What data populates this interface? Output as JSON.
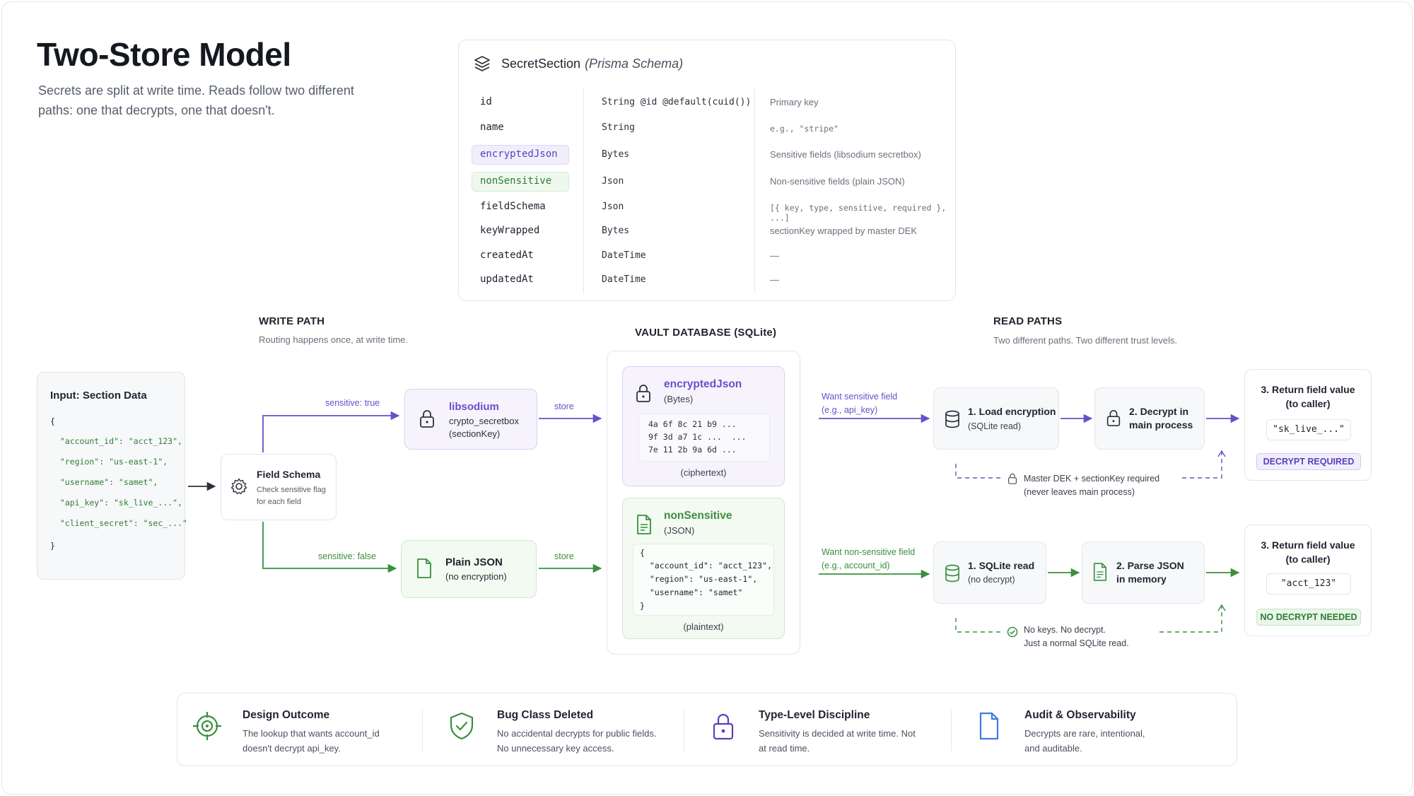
{
  "header": {
    "title": "Two-Store Model",
    "subtitle_line1": "Secrets are split at write time. Reads follow two different",
    "subtitle_line2": "paths: one that decrypts, one that doesn't."
  },
  "schema": {
    "model": "SecretSection",
    "model_note": "(Prisma Schema)",
    "rows": [
      {
        "name": "id",
        "type": "String @id @default(cuid())",
        "desc": "Primary key"
      },
      {
        "name": "name",
        "type": "String",
        "desc": "e.g., \"stripe\""
      },
      {
        "name": "encryptedJson",
        "type": "Bytes",
        "desc": "Sensitive fields (libsodium secretbox)"
      },
      {
        "name": "nonSensitive",
        "type": "Json",
        "desc": "Non-sensitive fields (plain JSON)"
      },
      {
        "name": "fieldSchema",
        "type": "Json",
        "desc": "[{ key, type, sensitive, required }, ...]"
      },
      {
        "name": "keyWrapped",
        "type": "Bytes",
        "desc": "sectionKey wrapped by master DEK"
      },
      {
        "name": "createdAt",
        "type": "DateTime",
        "desc": "—"
      },
      {
        "name": "updatedAt",
        "type": "DateTime",
        "desc": "—"
      }
    ]
  },
  "write_path": {
    "title": "WRITE PATH",
    "subtitle": "Routing happens once, at write time.",
    "input_title": "Input: Section Data",
    "input_lines": [
      "{",
      "  \"account_id\": \"acct_123\",",
      "  \"region\": \"us-east-1\",",
      "  \"username\": \"samet\",",
      "  \"api_key\": \"sk_live_...\",",
      "  \"client_secret\": \"sec_...\"",
      "}"
    ],
    "field_schema_title": "Field Schema",
    "field_schema_sub": "Check sensitive flag for each field",
    "edge_true": "sensitive: true",
    "edge_false": "sensitive: false",
    "libsodium_title": "libsodium",
    "libsodium_sub1": "crypto_secretbox",
    "libsodium_sub2": "(sectionKey)",
    "plain_title": "Plain JSON",
    "plain_sub": "(no encryption)",
    "store_label": "store"
  },
  "vault": {
    "title": "VAULT DATABASE (SQLite)",
    "enc_title": "encryptedJson",
    "enc_sub": "(Bytes)",
    "hex_lines": [
      "4a 6f 8c 21 b9 ...",
      "9f 3d a7 1c ...  ...",
      "7e 11 2b 9a 6d ..."
    ],
    "enc_caption": "(ciphertext)",
    "ns_title": "nonSensitive",
    "ns_sub": "(JSON)",
    "json_lines": [
      "{",
      "  \"account_id\": \"acct_123\",",
      "  \"region\": \"us-east-1\",",
      "  \"username\": \"samet\"",
      "}"
    ],
    "ns_caption": "(plaintext)"
  },
  "read_paths": {
    "title": "READ PATHS",
    "subtitle": "Two different paths. Two different trust levels.",
    "sensitive": {
      "want_line1": "Want sensitive field",
      "want_line2": "(e.g., api_key)",
      "step1_title": "1. Load encryption",
      "step1_sub": "(SQLite read)",
      "step2_title_l1": "2. Decrypt in",
      "step2_title_l2": "main process",
      "step3_title_l1": "3. Return field value",
      "step3_title_l2": "(to caller)",
      "value": "\"sk_live_...\"",
      "badge": "DECRYPT REQUIRED",
      "note_l1": "Master DEK + sectionKey required",
      "note_l2": "(never leaves main process)"
    },
    "non_sensitive": {
      "want_line1": "Want non-sensitive field",
      "want_line2": "(e.g., account_id)",
      "step1_title": "1. SQLite read",
      "step1_sub": "(no decrypt)",
      "step2_title_l1": "2. Parse JSON",
      "step2_title_l2": "in memory",
      "step3_title_l1": "3. Return field value",
      "step3_title_l2": "(to caller)",
      "value": "\"acct_123\"",
      "badge": "NO DECRYPT NEEDED",
      "note_l1": "No keys. No decrypt.",
      "note_l2": "Just a normal SQLite read."
    }
  },
  "footer": [
    {
      "title": "Design Outcome",
      "desc": "The lookup that wants account_id doesn't decrypt api_key.",
      "icon": "crosshair-icon"
    },
    {
      "title": "Bug Class Deleted",
      "desc": "No accidental decrypts for public fields. No unnecessary key access.",
      "icon": "shield-check-icon"
    },
    {
      "title": "Type-Level Discipline",
      "desc": "Sensitivity is decided at write time. Not at read time.",
      "icon": "lock-icon"
    },
    {
      "title": "Audit & Observability",
      "desc": "Decrypts are rare, intentional, and auditable.",
      "icon": "document-icon"
    }
  ],
  "colors": {
    "purple": "#6a4fc9",
    "green": "#3a8f3e",
    "border": "#e3e5ea"
  }
}
